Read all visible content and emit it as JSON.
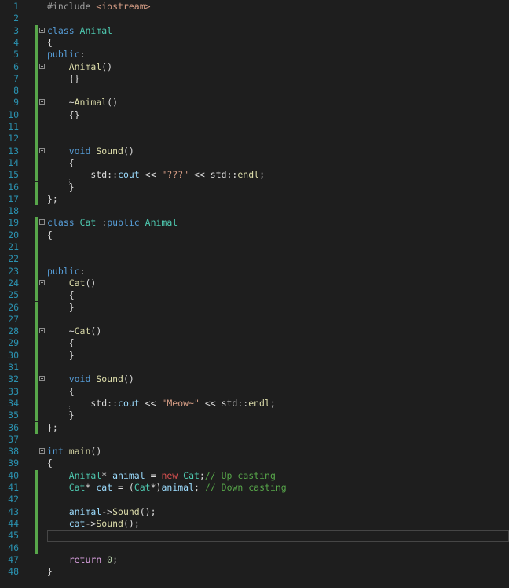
{
  "editor": {
    "colors": {
      "line_number": "#2b91af",
      "change_bar": "#57a64a",
      "background": "#1e1e1e"
    },
    "lines": [
      {
        "n": "1",
        "tokens": [
          {
            "c": "pp",
            "t": "#include "
          },
          {
            "c": "str",
            "t": "<iostream>"
          }
        ]
      },
      {
        "n": "2",
        "tokens": []
      },
      {
        "n": "3",
        "fold": true,
        "tokens": [
          {
            "c": "kw",
            "t": "class "
          },
          {
            "c": "type",
            "t": "Animal"
          }
        ]
      },
      {
        "n": "4",
        "tokens": [
          {
            "c": "txt",
            "t": "{"
          }
        ]
      },
      {
        "n": "5",
        "tokens": [
          {
            "c": "kw",
            "t": "public"
          },
          {
            "c": "txt",
            "t": ":"
          }
        ]
      },
      {
        "n": "6",
        "fold": true,
        "tokens": [
          {
            "c": "txt",
            "t": "    "
          },
          {
            "c": "fn",
            "t": "Animal"
          },
          {
            "c": "txt",
            "t": "()"
          }
        ]
      },
      {
        "n": "7",
        "tokens": [
          {
            "c": "txt",
            "t": "    {}"
          }
        ]
      },
      {
        "n": "8",
        "tokens": []
      },
      {
        "n": "9",
        "fold": true,
        "tokens": [
          {
            "c": "txt",
            "t": "    ~"
          },
          {
            "c": "fn",
            "t": "Animal"
          },
          {
            "c": "txt",
            "t": "()"
          }
        ]
      },
      {
        "n": "10",
        "tokens": [
          {
            "c": "txt",
            "t": "    {}"
          }
        ]
      },
      {
        "n": "11",
        "tokens": []
      },
      {
        "n": "12",
        "tokens": []
      },
      {
        "n": "13",
        "fold": true,
        "tokens": [
          {
            "c": "txt",
            "t": "    "
          },
          {
            "c": "kw",
            "t": "void "
          },
          {
            "c": "fn",
            "t": "Sound"
          },
          {
            "c": "txt",
            "t": "()"
          }
        ]
      },
      {
        "n": "14",
        "tokens": [
          {
            "c": "txt",
            "t": "    {"
          }
        ]
      },
      {
        "n": "15",
        "tokens": [
          {
            "c": "txt",
            "t": "        std::"
          },
          {
            "c": "var",
            "t": "cout"
          },
          {
            "c": "txt",
            "t": " << "
          },
          {
            "c": "str",
            "t": "\"???\""
          },
          {
            "c": "txt",
            "t": " << std::"
          },
          {
            "c": "fn",
            "t": "endl"
          },
          {
            "c": "txt",
            "t": ";"
          }
        ]
      },
      {
        "n": "16",
        "tokens": [
          {
            "c": "txt",
            "t": "    }"
          }
        ]
      },
      {
        "n": "17",
        "tokens": [
          {
            "c": "txt",
            "t": "};"
          }
        ]
      },
      {
        "n": "18",
        "tokens": []
      },
      {
        "n": "19",
        "fold": true,
        "tokens": [
          {
            "c": "kw",
            "t": "class "
          },
          {
            "c": "type",
            "t": "Cat"
          },
          {
            "c": "txt",
            "t": " :"
          },
          {
            "c": "kw",
            "t": "public "
          },
          {
            "c": "type",
            "t": "Animal"
          }
        ]
      },
      {
        "n": "20",
        "tokens": [
          {
            "c": "txt",
            "t": "{"
          }
        ]
      },
      {
        "n": "21",
        "tokens": []
      },
      {
        "n": "22",
        "tokens": []
      },
      {
        "n": "23",
        "tokens": [
          {
            "c": "kw",
            "t": "public"
          },
          {
            "c": "txt",
            "t": ":"
          }
        ]
      },
      {
        "n": "24",
        "fold": true,
        "tokens": [
          {
            "c": "txt",
            "t": "    "
          },
          {
            "c": "fn",
            "t": "Cat"
          },
          {
            "c": "txt",
            "t": "()"
          }
        ]
      },
      {
        "n": "25",
        "tokens": [
          {
            "c": "txt",
            "t": "    {"
          }
        ]
      },
      {
        "n": "26",
        "tokens": [
          {
            "c": "txt",
            "t": "    }"
          }
        ]
      },
      {
        "n": "27",
        "tokens": []
      },
      {
        "n": "28",
        "fold": true,
        "tokens": [
          {
            "c": "txt",
            "t": "    ~"
          },
          {
            "c": "fn",
            "t": "Cat"
          },
          {
            "c": "txt",
            "t": "()"
          }
        ]
      },
      {
        "n": "29",
        "tokens": [
          {
            "c": "txt",
            "t": "    {"
          }
        ]
      },
      {
        "n": "30",
        "tokens": [
          {
            "c": "txt",
            "t": "    }"
          }
        ]
      },
      {
        "n": "31",
        "tokens": []
      },
      {
        "n": "32",
        "fold": true,
        "tokens": [
          {
            "c": "txt",
            "t": "    "
          },
          {
            "c": "kw",
            "t": "void "
          },
          {
            "c": "fn",
            "t": "Sound"
          },
          {
            "c": "txt",
            "t": "()"
          }
        ]
      },
      {
        "n": "33",
        "tokens": [
          {
            "c": "txt",
            "t": "    {"
          }
        ]
      },
      {
        "n": "34",
        "tokens": [
          {
            "c": "txt",
            "t": "        std::"
          },
          {
            "c": "var",
            "t": "cout"
          },
          {
            "c": "txt",
            "t": " << "
          },
          {
            "c": "str",
            "t": "\"Meow~\""
          },
          {
            "c": "txt",
            "t": " << std::"
          },
          {
            "c": "fn",
            "t": "endl"
          },
          {
            "c": "txt",
            "t": ";"
          }
        ]
      },
      {
        "n": "35",
        "tokens": [
          {
            "c": "txt",
            "t": "    }"
          }
        ]
      },
      {
        "n": "36",
        "tokens": [
          {
            "c": "txt",
            "t": "};"
          }
        ]
      },
      {
        "n": "37",
        "tokens": []
      },
      {
        "n": "38",
        "fold": true,
        "tokens": [
          {
            "c": "kw",
            "t": "int "
          },
          {
            "c": "fn",
            "t": "main"
          },
          {
            "c": "txt",
            "t": "()"
          }
        ]
      },
      {
        "n": "39",
        "tokens": [
          {
            "c": "txt",
            "t": "{"
          }
        ]
      },
      {
        "n": "40",
        "tokens": [
          {
            "c": "txt",
            "t": "    "
          },
          {
            "c": "type",
            "t": "Animal"
          },
          {
            "c": "txt",
            "t": "* "
          },
          {
            "c": "var",
            "t": "animal"
          },
          {
            "c": "txt",
            "t": " = "
          },
          {
            "c": "newkw",
            "t": "new "
          },
          {
            "c": "type",
            "t": "Cat"
          },
          {
            "c": "txt",
            "t": ";"
          },
          {
            "c": "cm",
            "t": "// Up casting"
          }
        ]
      },
      {
        "n": "41",
        "tokens": [
          {
            "c": "txt",
            "t": "    "
          },
          {
            "c": "type",
            "t": "Cat"
          },
          {
            "c": "txt",
            "t": "* "
          },
          {
            "c": "var",
            "t": "cat"
          },
          {
            "c": "txt",
            "t": " = ("
          },
          {
            "c": "type",
            "t": "Cat"
          },
          {
            "c": "txt",
            "t": "*)"
          },
          {
            "c": "var",
            "t": "animal"
          },
          {
            "c": "txt",
            "t": "; "
          },
          {
            "c": "cm",
            "t": "// Down casting"
          }
        ]
      },
      {
        "n": "42",
        "tokens": []
      },
      {
        "n": "43",
        "tokens": [
          {
            "c": "txt",
            "t": "    "
          },
          {
            "c": "var",
            "t": "animal"
          },
          {
            "c": "txt",
            "t": "->"
          },
          {
            "c": "fn",
            "t": "Sound"
          },
          {
            "c": "txt",
            "t": "();"
          }
        ]
      },
      {
        "n": "44",
        "tokens": [
          {
            "c": "txt",
            "t": "    "
          },
          {
            "c": "var",
            "t": "cat"
          },
          {
            "c": "txt",
            "t": "->"
          },
          {
            "c": "fn",
            "t": "Sound"
          },
          {
            "c": "txt",
            "t": "();"
          }
        ]
      },
      {
        "n": "45",
        "current": true,
        "tokens": []
      },
      {
        "n": "46",
        "tokens": []
      },
      {
        "n": "47",
        "tokens": [
          {
            "c": "txt",
            "t": "    "
          },
          {
            "c": "ctl",
            "t": "return "
          },
          {
            "c": "num",
            "t": "0"
          },
          {
            "c": "txt",
            "t": ";"
          }
        ]
      },
      {
        "n": "48",
        "tokens": [
          {
            "c": "txt",
            "t": "}"
          }
        ]
      }
    ],
    "changed_lines": [
      "3",
      "4",
      "5",
      "6",
      "7",
      "8",
      "9",
      "10",
      "11",
      "12",
      "13",
      "14",
      "15",
      "16",
      "17",
      "19",
      "20",
      "21",
      "22",
      "23",
      "24",
      "25",
      "26",
      "27",
      "28",
      "29",
      "30",
      "31",
      "32",
      "33",
      "34",
      "35",
      "36",
      "40",
      "41",
      "42",
      "43",
      "44",
      "45",
      "46"
    ]
  }
}
